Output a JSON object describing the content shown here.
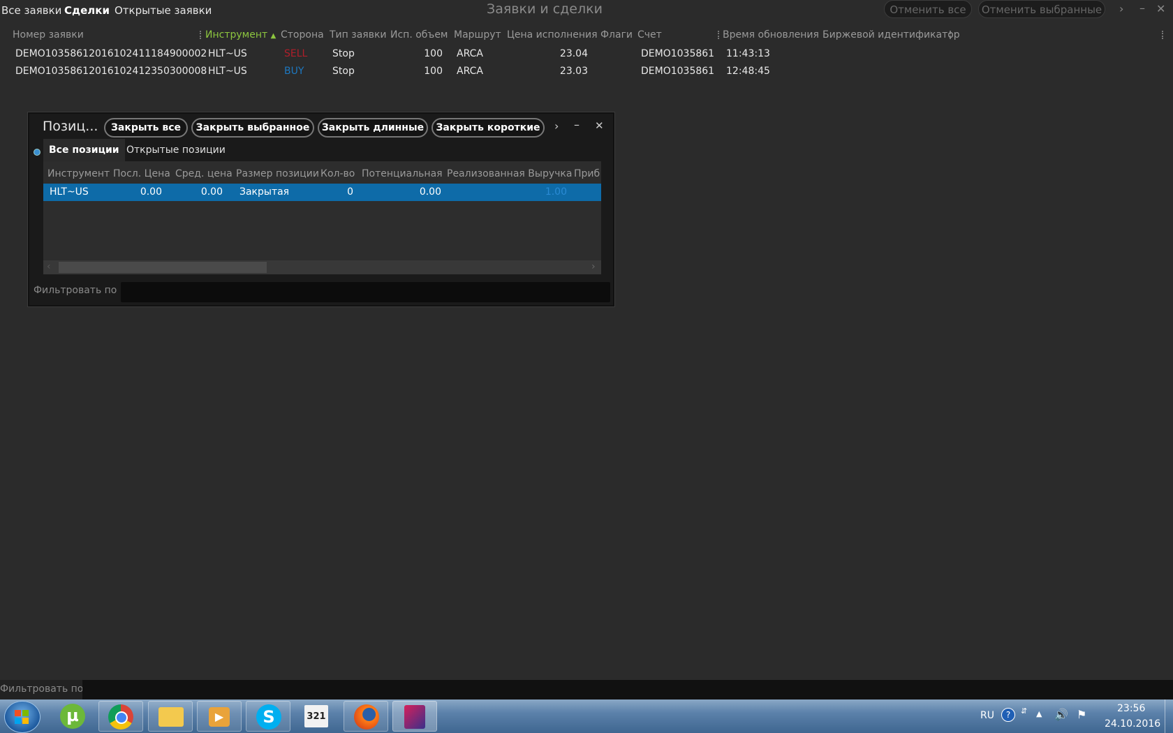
{
  "tabs": [
    "Все заявки",
    "Сделки",
    "Открытые заявки"
  ],
  "window_title": "Заявки и сделки",
  "cancel_all": "Отменить все",
  "cancel_selected": "Отменить выбранные",
  "orders": {
    "headers": [
      "Номер заявки",
      "Инструмент",
      "Сторона",
      "Тип заявки",
      "Исп. объем",
      "Маршрут",
      "Цена исполнения",
      "Флаги",
      "Счет",
      "Время обновления",
      "Биржевой идентификатор"
    ],
    "rows": [
      {
        "id": "DEMO1035861201610241118490000​2",
        "instrument": "HLT~US",
        "side": "SELL",
        "type": "Stop",
        "volume": "100",
        "route": "ARCA",
        "price": "23.04",
        "account": "DEMO1035861",
        "time": "11:43:13"
      },
      {
        "id": "DEMO10358612016102412350300008",
        "instrument": "HLT~US",
        "side": "BUY",
        "type": "Stop",
        "volume": "100",
        "route": "ARCA",
        "price": "23.03",
        "account": "DEMO1035861",
        "time": "12:48:45"
      }
    ]
  },
  "positions": {
    "title": "Позиц...",
    "buttons": [
      "Закрыть все",
      "Закрыть выбранное",
      "Закрыть длинные",
      "Закрыть короткие"
    ],
    "tabs": [
      "Все позиции",
      "Открытые позиции"
    ],
    "headers": [
      "Инструмент",
      "Посл. Цена",
      "Сред. цена",
      "Размер позиции",
      "Кол-во",
      "Потенциальная",
      "Реализованная Выручка",
      "Приб"
    ],
    "row": {
      "instrument": "HLT~US",
      "last": "0.00",
      "avg": "0.00",
      "size": "Закрытая",
      "qty": "0",
      "potential": "0.00",
      "realized": "1.00"
    },
    "filter_label": "Фильтровать по"
  },
  "bottom_filter_label": "Фильтровать по",
  "tray": {
    "lang": "RU",
    "time": "23:56",
    "date": "24.10.2016"
  },
  "colors": {
    "sell": "#b01e2a",
    "buy": "#1d78c0",
    "sorted": "#8dc63f",
    "selection": "#0e6ba8"
  }
}
